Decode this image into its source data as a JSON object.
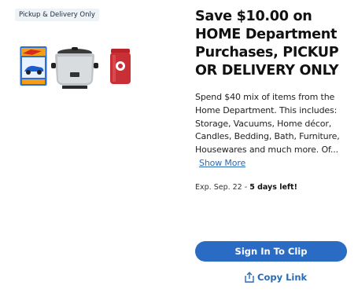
{
  "badge": "Pickup & Delivery Only",
  "offer": {
    "title": "Save $10.00 on HOME Department Purchases, PICKUP OR DELIVERY ONLY",
    "description": "Spend $40 mix of items from the Home Department. This includes: Storage, Vacuums, Home décor, Candles, Bedding, Bath, Furniture, Housewares and much more. Of...",
    "show_more": "Show More",
    "expiry_prefix": "Exp. Sep. 22 - ",
    "expiry_emphasis": "5 days left!"
  },
  "actions": {
    "clip": "Sign In To Clip",
    "copy": "Copy Link"
  },
  "images": [
    "hot-wheels-car-package",
    "slow-cooker",
    "red-candle-jar"
  ],
  "colors": {
    "accent": "#2a6bc4",
    "link": "#2a6bb7",
    "badge_bg": "#eef3f8"
  }
}
